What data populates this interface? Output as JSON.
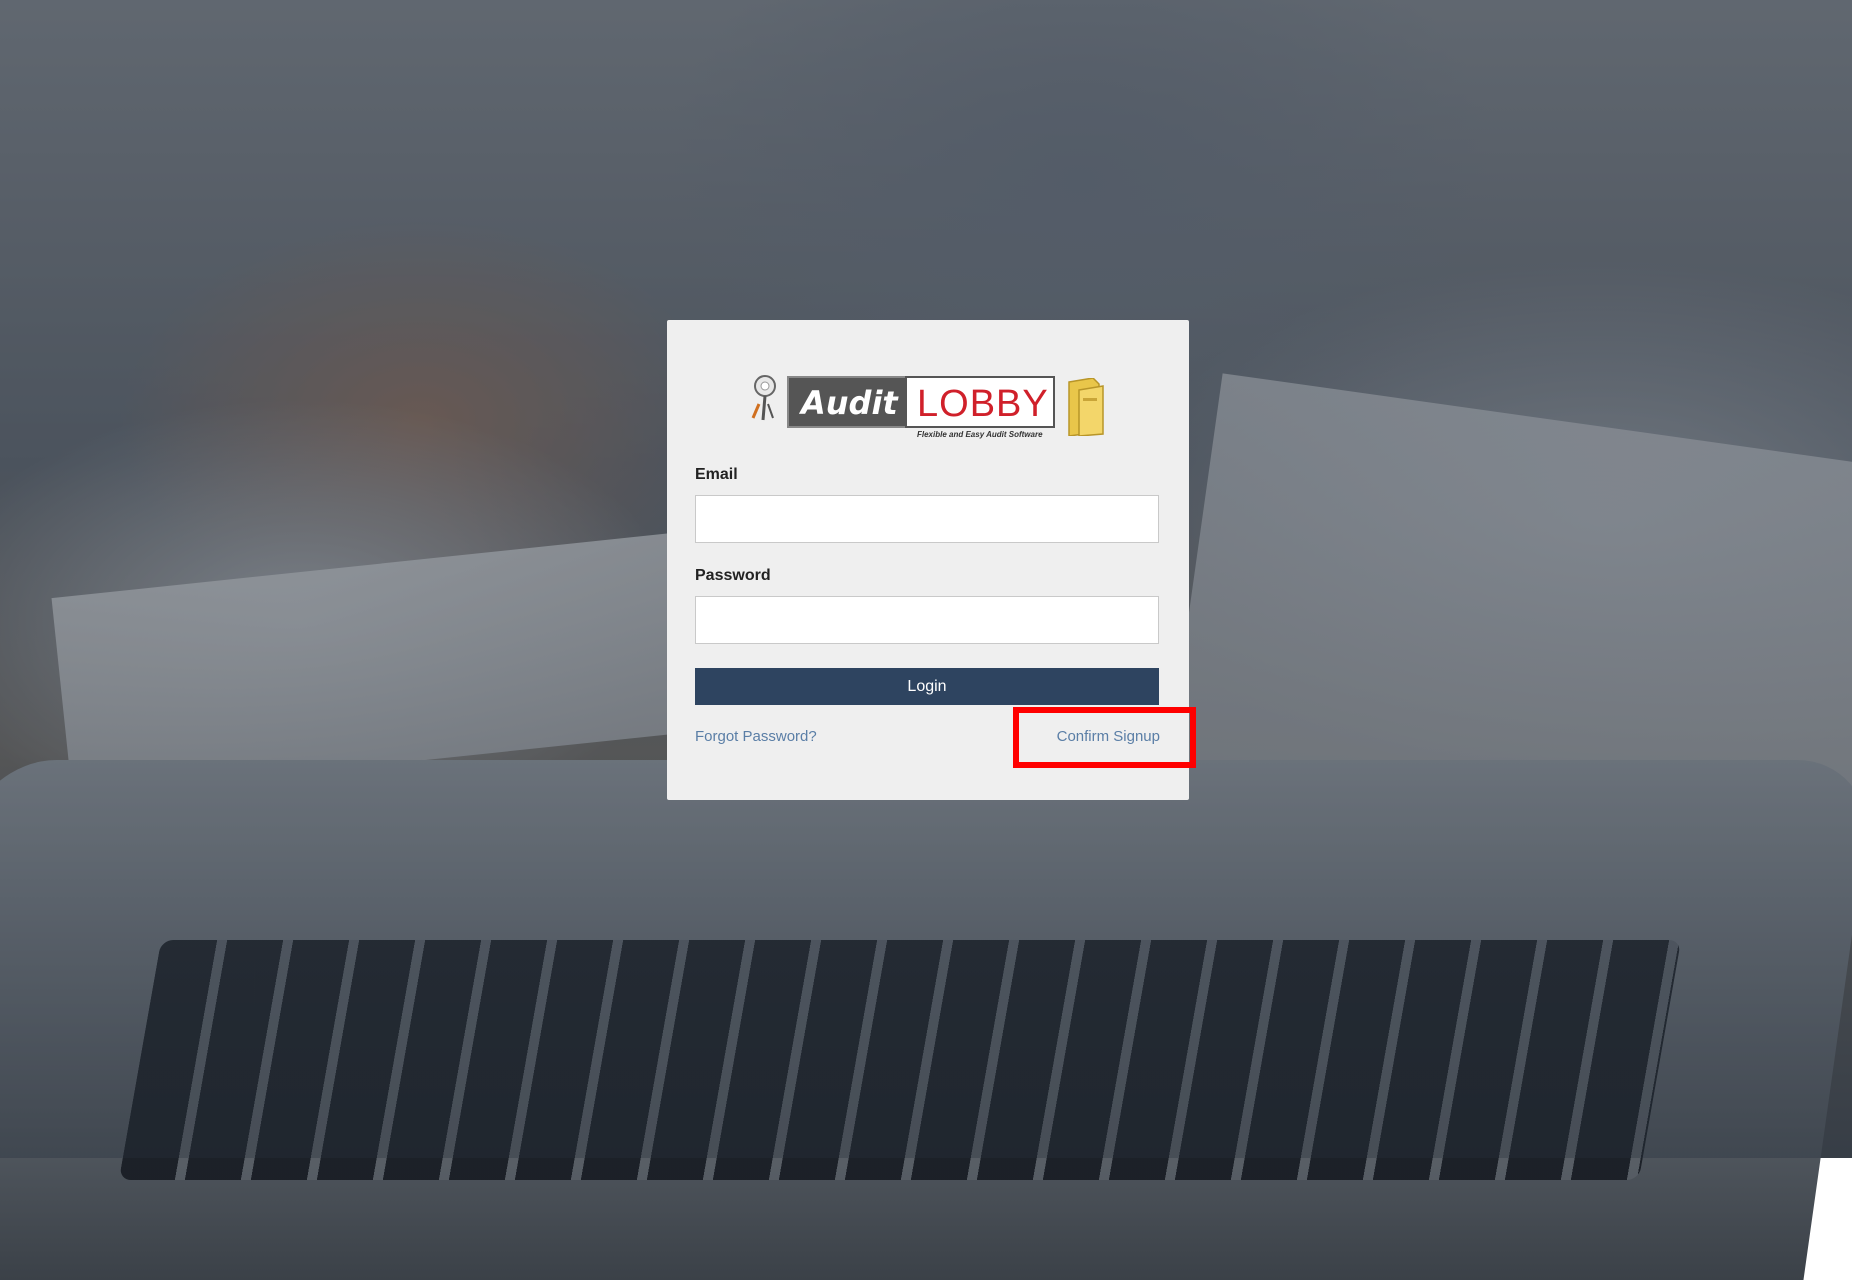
{
  "logo": {
    "brand_left": "Audit",
    "brand_right": "LOBBY",
    "tagline": "Flexible and Easy Audit Software"
  },
  "form": {
    "email_label": "Email",
    "email_value": "",
    "password_label": "Password",
    "password_value": "",
    "login_label": "Login",
    "forgot_label": "Forgot Password?",
    "confirm_label": "Confirm Signup"
  },
  "colors": {
    "button": "#2e4460",
    "link": "#5a7ea6",
    "highlight": "#ff0000",
    "brand_red": "#d0202a"
  },
  "icons": {
    "key": "key-icon",
    "folder": "folder-icon"
  }
}
